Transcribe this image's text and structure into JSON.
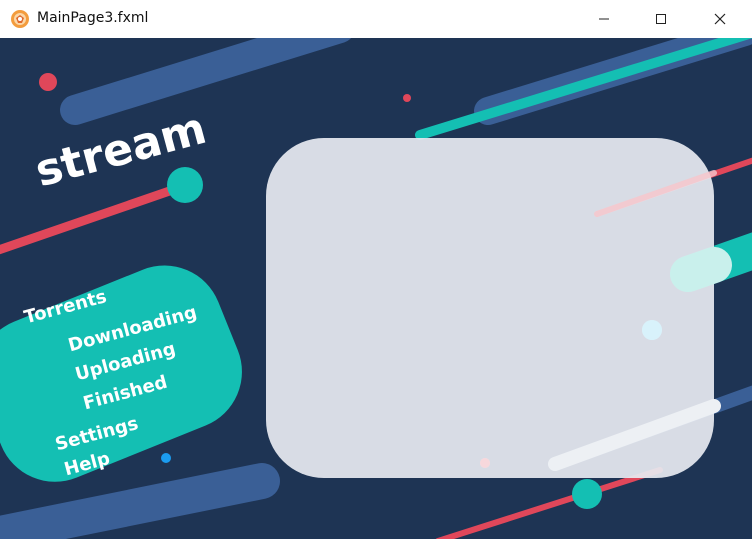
{
  "window": {
    "title": "MainPage3.fxml",
    "icons": [
      "app-icon",
      "minimize-icon",
      "maximize-icon",
      "close-icon"
    ]
  },
  "app": {
    "logo": "stream"
  },
  "menu": {
    "torrents": "Torrents",
    "downloading": "Downloading",
    "uploading": "Uploading",
    "finished": "Finished",
    "settings": "Settings",
    "help": "Help"
  },
  "colors": {
    "background": "#1e3454",
    "teal": "#14bfb3",
    "red": "#e0475a",
    "steel_blue": "#3a5f96",
    "panel": "#e6e9f0"
  }
}
